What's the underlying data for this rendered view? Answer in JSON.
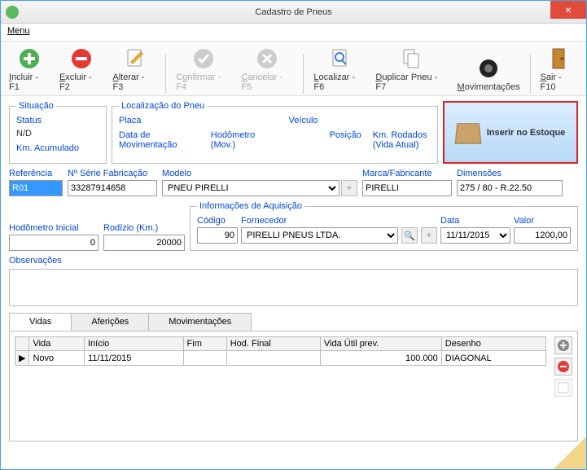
{
  "window": {
    "title": "Cadastro de Pneus"
  },
  "menu": {
    "label": "Menu"
  },
  "toolbar": {
    "incluir": "Incluir - F1",
    "excluir": "Excluir - F2",
    "alterar": "Alterar - F3",
    "confirmar": "Confirmar - F4",
    "cancelar": "Cancelar - F5",
    "localizar": "Localizar - F6",
    "duplicar": "Duplicar Pneu - F7",
    "movimentacoes": "Movimentações",
    "sair": "Sair - F10"
  },
  "situacao": {
    "legend": "Situação",
    "status_label": "Status",
    "status_value": "N/D",
    "km_acum": "Km. Acumulado"
  },
  "localizacao": {
    "legend": "Localização do Pneu",
    "placa": "Placa",
    "veiculo": "Veículo",
    "data_mov": "Data de Movimentação",
    "hodometro_mov": "Hodômetro (Mov.)",
    "posicao": "Posição",
    "km_rodados": "Km. Rodados (Vida Atual)"
  },
  "inserir_estoque": "Inserir no Estoque",
  "refs": {
    "referencia_label": "Referência",
    "referencia_value": "R01",
    "nserie_label": "Nº Série Fabricação",
    "nserie_value": "33287914658",
    "modelo_label": "Modelo",
    "modelo_value": "PNEU PIRELLI",
    "marca_label": "Marca/Fabricante",
    "marca_value": "PIRELLI",
    "dimensoes_label": "Dimensões",
    "dimensoes_value": "275 / 80 - R.22.50"
  },
  "hodometro": {
    "inicial_label": "Hodômetro Inicial",
    "inicial_value": "0",
    "rodizio_label": "Rodízio (Km.)",
    "rodizio_value": "20000"
  },
  "aquisicao": {
    "legend": "Informações de Aquisição",
    "codigo_label": "Código",
    "codigo_value": "90",
    "fornecedor_label": "Fornecedor",
    "fornecedor_value": "PIRELLI PNEUS LTDA.",
    "data_label": "Data",
    "data_value": "11/11/2015",
    "valor_label": "Valor",
    "valor_value": "1200,00"
  },
  "observacoes_label": "Observações",
  "tabs": {
    "vidas": "Vidas",
    "afericoes": "Aferições",
    "movimentacoes": "Movimentações"
  },
  "grid": {
    "headers": {
      "vida": "Vida",
      "inicio": "Início",
      "fim": "Fim",
      "hodfinal": "Hod. Final",
      "vidautil": "Vida Útil prev.",
      "desenho": "Desenho"
    },
    "rows": [
      {
        "vida": "Novo",
        "inicio": "11/11/2015",
        "fim": "",
        "hodfinal": "",
        "vidautil": "100.000",
        "desenho": "DIAGONAL"
      }
    ]
  }
}
